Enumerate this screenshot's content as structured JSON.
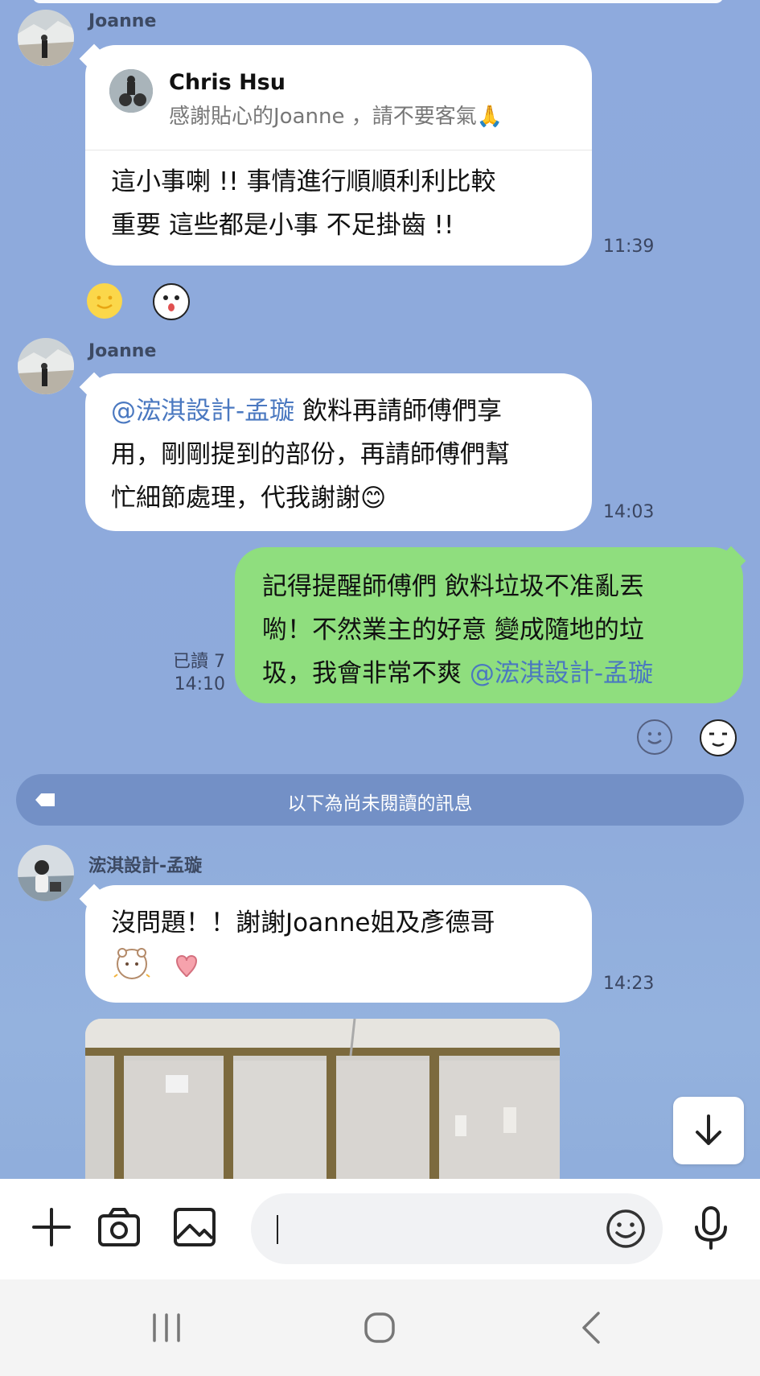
{
  "messages": {
    "m1": {
      "sender": "Joanne",
      "reply_to_name": "Chris Hsu",
      "reply_to_text": "感謝貼心的Joanne ，請不要客氣🙏",
      "line1": "這小事喇 !!  事情進行順順利利比較",
      "line2": "重要  這些都是小事 不足掛齒 !!",
      "time": "11:39"
    },
    "m2": {
      "sender": "Joanne",
      "mention": "@浤淇設計-孟璇",
      "line1_rest": " 飲料再請師傅們享",
      "line2": "用，剛剛提到的部份，再請師傅們幫",
      "line3": "忙細節處理，代我謝謝😊",
      "time": "14:03"
    },
    "m3": {
      "line1": "記得提醒師傅們  飲料垃圾不准亂丟",
      "line2": "喲！不然業主的好意  變成隨地的垃",
      "line3_text": "圾，我會非常不爽  ",
      "mention": "@浤淇設計-孟璇",
      "read": "已讀 7",
      "time": "14:10"
    },
    "unread_divider": "以下為尚未閱讀的訊息",
    "m4": {
      "sender": "浤淇設計-孟璇",
      "line1": "沒問題！！謝謝Joanne姐及彥德哥",
      "time": "14:23"
    }
  },
  "icons": {
    "reaction1": "smile-emoji-icon",
    "reaction2": "surprised-sticker-icon",
    "reaction_add": "add-reaction-icon",
    "reaction_hand": "thumbs-up-sticker-icon",
    "scroll": "arrow-down-icon",
    "plus": "plus-icon",
    "camera": "camera-icon",
    "image": "image-icon",
    "emoji": "emoji-icon",
    "mic": "microphone-icon",
    "nav_recent": "recent-apps-icon",
    "nav_home": "home-icon",
    "nav_back": "back-icon"
  },
  "colors": {
    "background": "#8eaadd",
    "outgoing_bubble": "#8fde7e",
    "incoming_bubble": "#ffffff",
    "mention": "#4a78c0"
  }
}
